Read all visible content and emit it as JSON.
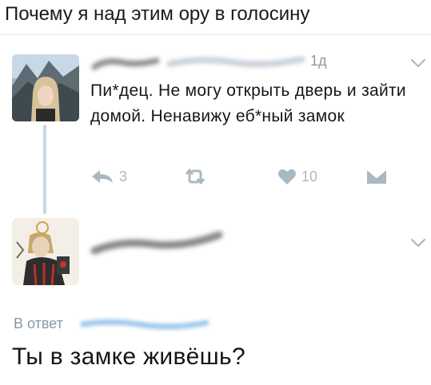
{
  "caption": "Почему я над этим ору в голосину",
  "tweet1": {
    "time": "1д",
    "text": "Пи*дец. Не могу открыть дверь и зайти домой. Ненавижу еб*ный замок",
    "reply_count": "3",
    "like_count": "10"
  },
  "reply": {
    "in_reply_to_label": "В ответ",
    "text": "Ты в замке живёшь?"
  },
  "colors": {
    "muted": "#8899a6",
    "icon": "#aab8c2",
    "thread_line": "#cdd7df"
  }
}
